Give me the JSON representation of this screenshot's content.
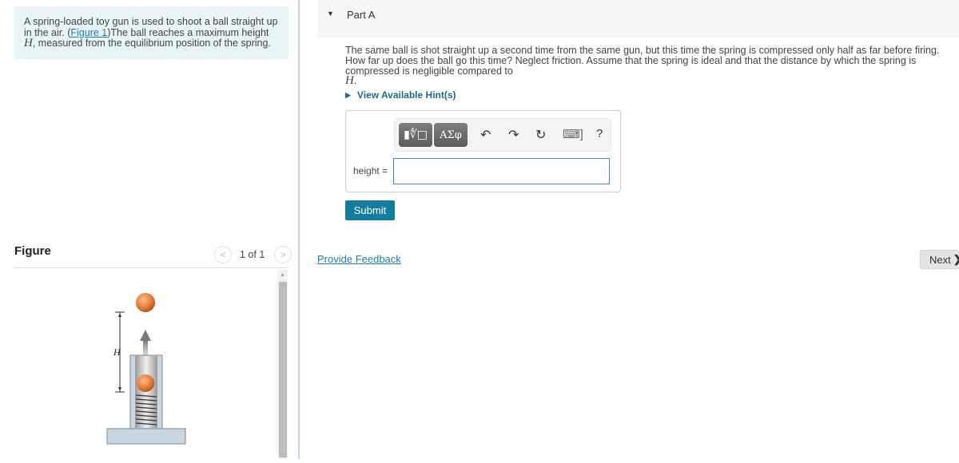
{
  "intro": {
    "text_before_link": "A spring-loaded toy gun is used to shoot a ball straight up in the air. (",
    "figure_link": "Figure 1",
    "text_after_link": ")The ball reaches a maximum height ",
    "var_H": "H",
    "text_end": ", measured from the equilibrium position of the spring."
  },
  "figure": {
    "title": "Figure",
    "prev_icon": "chevron-left-icon",
    "next_icon": "chevron-right-icon",
    "page_count": "1 of 1",
    "label_H": "H"
  },
  "part": {
    "toggle_icon": "▼",
    "title": "Part A",
    "question_text": "The same ball is shot straight up a second time from the same gun, but this time the spring is compressed only half as far before firing. How far up does the ball go this time? Neglect friction. Assume that the spring is ideal and that the distance by which the spring is compressed is negligible compared to ",
    "question_var": "H",
    "question_end": ".",
    "hints_label": "View Available Hint(s)",
    "hints_icon": "▶"
  },
  "toolbar": {
    "template_label": "▮∜□",
    "greek_label": "ΑΣφ",
    "undo": "↶",
    "redo": "↷",
    "reset": "↻",
    "keyboard": "⌨]",
    "help": "?"
  },
  "answer": {
    "label": "height =",
    "value": ""
  },
  "buttons": {
    "submit": "Submit",
    "feedback": "Provide Feedback",
    "next": "Next",
    "next_icon": "❯"
  }
}
